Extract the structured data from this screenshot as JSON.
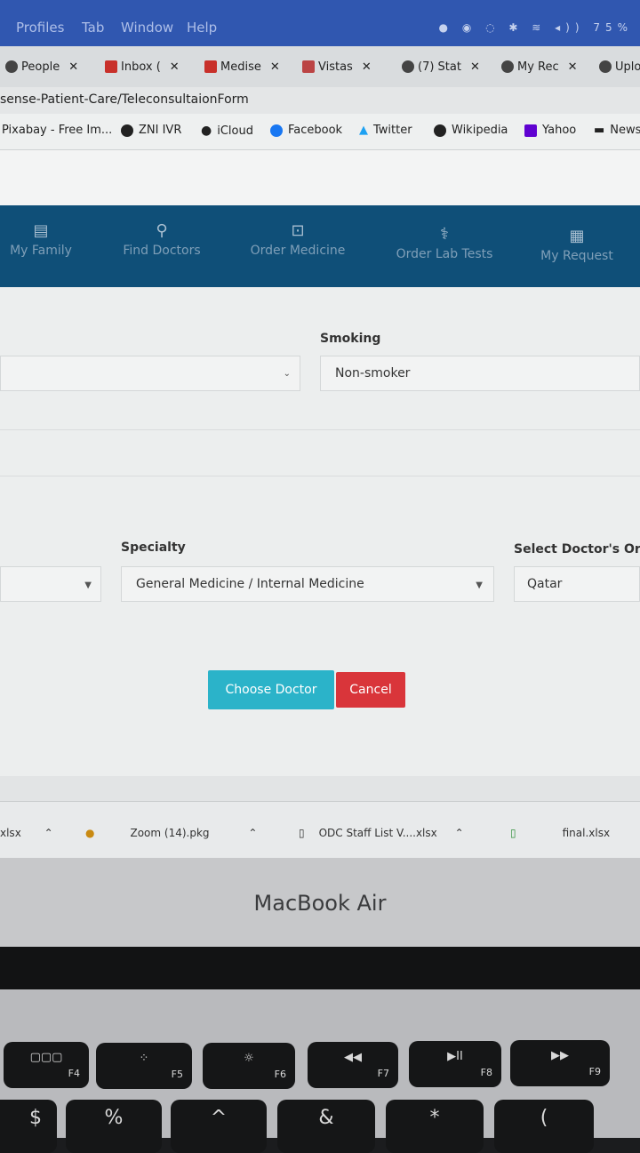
{
  "menubar": {
    "items": [
      "Profiles",
      "Tab",
      "Window",
      "Help"
    ],
    "battery": "75%"
  },
  "tabs": [
    {
      "label": "People"
    },
    {
      "label": "Inbox ("
    },
    {
      "label": "Medise"
    },
    {
      "label": "Vistas"
    },
    {
      "label": "(7) Stat"
    },
    {
      "label": "My Rec"
    },
    {
      "label": "Uplo"
    }
  ],
  "url": "sense-Patient-Care/TeleconsultaionForm",
  "bookmarks": [
    "Pixabay - Free Im...",
    "ZNI IVR",
    "iCloud",
    "Facebook",
    "Twitter",
    "Wikipedia",
    "Yahoo",
    "News"
  ],
  "nav": {
    "items": [
      "My Family",
      "Find Doctors",
      "Order Medicine",
      "Order Lab Tests",
      "My Request"
    ]
  },
  "form": {
    "smoking_label": "Smoking",
    "smoking_value": "Non-smoker",
    "specialty_label": "Specialty",
    "specialty_value": "General Medicine / Internal Medicine",
    "origin_label": "Select Doctor's Orig",
    "origin_value": "Qatar",
    "choose_label": "Choose Doctor",
    "cancel_label": "Cancel"
  },
  "downloads": [
    "xlsx",
    "Zoom (14).pkg",
    "ODC Staff List V....xlsx",
    "final.xlsx"
  ],
  "laptop": {
    "brand": "MacBook Air",
    "fkeys": [
      {
        "label": "F4",
        "glyph": "▢▢▢"
      },
      {
        "label": "F5",
        "glyph": "⁘"
      },
      {
        "label": "F6",
        "glyph": "☼"
      },
      {
        "label": "F7",
        "glyph": "◀◀"
      },
      {
        "label": "F8",
        "glyph": "▶II"
      },
      {
        "label": "F9",
        "glyph": "▶▶"
      }
    ],
    "numkeys": [
      "$",
      "%",
      "^",
      "&",
      "*",
      "("
    ]
  },
  "colors": {
    "nav_bg": "#0f4f78",
    "choose_btn": "#2bb3c9",
    "cancel_btn": "#d9353a"
  }
}
